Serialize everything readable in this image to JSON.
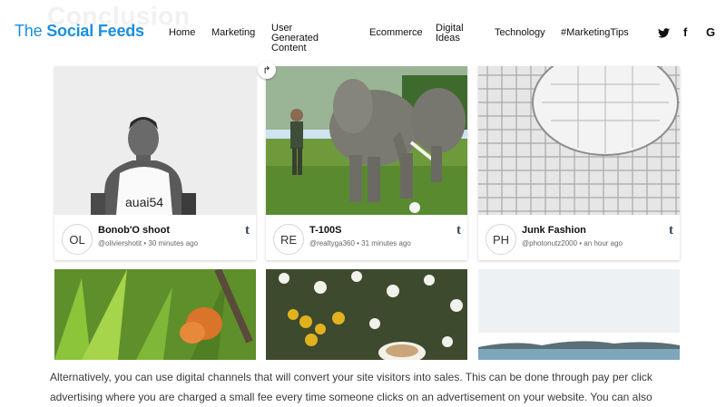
{
  "background_heading": "Conclusion",
  "logo": {
    "part1": "The ",
    "part2": "Social Feeds"
  },
  "nav": [
    {
      "label": "Home"
    },
    {
      "label": "Marketing"
    },
    {
      "label": "User Generated Content"
    },
    {
      "label": "Ecommerce"
    },
    {
      "label": "Digital Ideas"
    },
    {
      "label": "Technology"
    },
    {
      "label": "#MarketingTips"
    }
  ],
  "social": [
    {
      "icon": "twitter-icon",
      "glyph": "🐦"
    },
    {
      "icon": "facebook-icon",
      "glyph": "f"
    },
    {
      "icon": "google-icon",
      "glyph": "G"
    }
  ],
  "cards": [
    {
      "initials": "OL",
      "title": "Bonob'O shoot",
      "meta": "@oliviershotit • 30 minutes ago",
      "network_glyph": "t",
      "image": "basketball player in jersey, black and white"
    },
    {
      "initials": "RE",
      "title": "T-100S",
      "meta": "@realtyga360 • 31 minutes ago",
      "network_glyph": "t",
      "image": "man standing next to elephants"
    },
    {
      "initials": "PH",
      "title": "Junk Fashion",
      "meta": "@photonutz2000 • an hour ago",
      "network_glyph": "t",
      "image": "white grid architecture structure"
    }
  ],
  "share_glyph": "↱",
  "article_text": "Alternatively, you can use digital channels that will convert your site visitors into sales. This can be done through pay per click advertising where you are charged a small fee every time someone clicks on an advertisement on your website. You can also"
}
